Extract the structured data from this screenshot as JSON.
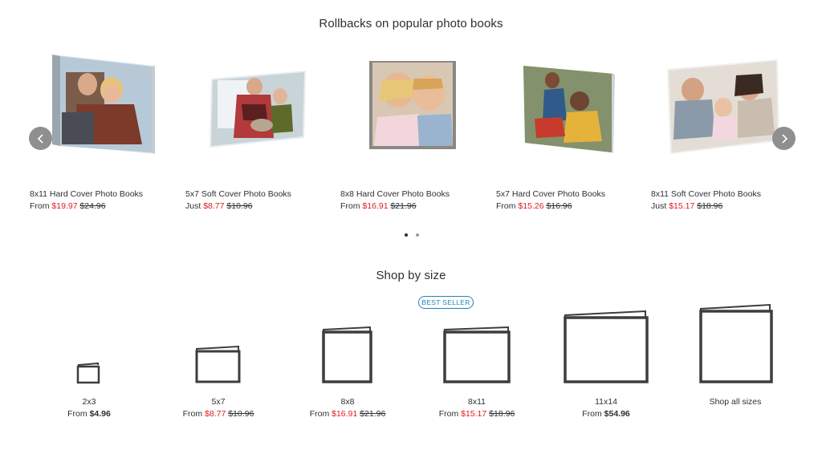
{
  "rollbacks": {
    "title": "Rollbacks on popular photo books",
    "products": [
      {
        "name": "8x11 Hard Cover Photo Books",
        "prefix": "From",
        "sale": "$19.97",
        "was": "$24.96"
      },
      {
        "name": "5x7 Soft Cover Photo Books",
        "prefix": "Just",
        "sale": "$8.77",
        "was": "$10.96"
      },
      {
        "name": "8x8 Hard Cover Photo Books",
        "prefix": "From",
        "sale": "$16.91",
        "was": "$21.96"
      },
      {
        "name": "5x7 Hard Cover Photo Books",
        "prefix": "From",
        "sale": "$15.26",
        "was": "$16.96"
      },
      {
        "name": "8x11 Soft Cover Photo Books",
        "prefix": "Just",
        "sale": "$15.17",
        "was": "$18.96"
      }
    ],
    "arrows": {
      "prev_icon": "chevron-left-icon",
      "next_icon": "chevron-right-icon"
    },
    "pagination": {
      "pages": 2,
      "current": 1
    }
  },
  "sizes": {
    "title": "Shop by size",
    "badge": "BEST SELLER",
    "items": [
      {
        "label": "2x3",
        "prefix": "From",
        "price": "$4.96",
        "sale": "",
        "was": ""
      },
      {
        "label": "5x7",
        "prefix": "From",
        "price": "",
        "sale": "$8.77",
        "was": "$10.96"
      },
      {
        "label": "8x8",
        "prefix": "From",
        "price": "",
        "sale": "$16.91",
        "was": "$21.96"
      },
      {
        "label": "8x11",
        "prefix": "From",
        "price": "",
        "sale": "$15.17",
        "was": "$18.96"
      },
      {
        "label": "11x14",
        "prefix": "From",
        "price": "$54.96",
        "sale": "",
        "was": ""
      },
      {
        "label": "Shop all sizes",
        "prefix": "",
        "price": "",
        "sale": "",
        "was": ""
      }
    ]
  },
  "colors": {
    "sale": "#de1c24",
    "badge": "#1f86b9",
    "text": "#2e2f32",
    "arrow": "#8f8f8f"
  }
}
